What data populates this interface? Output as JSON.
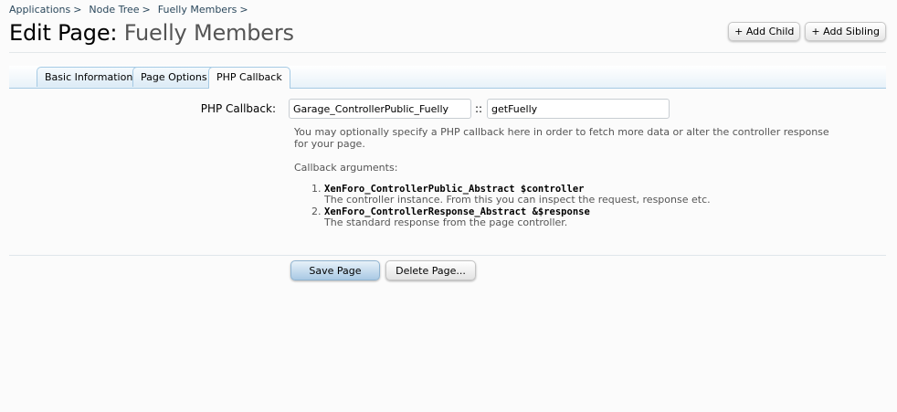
{
  "breadcrumb": {
    "items": [
      "Applications",
      "Node Tree",
      "Fuelly Members"
    ],
    "separator": ">"
  },
  "header": {
    "title_prefix": "Edit Page:",
    "title_node": "Fuelly Members",
    "buttons": {
      "add_child": "+ Add Child",
      "add_sibling": "+ Add Sibling"
    }
  },
  "tabs": [
    {
      "label": "Basic Information",
      "active": false
    },
    {
      "label": "Page Options",
      "active": false
    },
    {
      "label": "PHP Callback",
      "active": true
    }
  ],
  "form": {
    "callback_label": "PHP Callback:",
    "class_value": "Garage_ControllerPublic_Fuelly",
    "separator": "::",
    "method_value": "getFuelly",
    "explain": "You may optionally specify a PHP callback here in order to fetch more data or alter the controller response for your page.",
    "args_heading": "Callback arguments:",
    "args": [
      {
        "signature": "XenForo_ControllerPublic_Abstract $controller",
        "description": "The controller instance. From this you can inspect the request, response etc."
      },
      {
        "signature": "XenForo_ControllerResponse_Abstract &$response",
        "description": "The standard response from the page controller."
      }
    ]
  },
  "actions": {
    "save": "Save Page",
    "delete": "Delete Page..."
  }
}
